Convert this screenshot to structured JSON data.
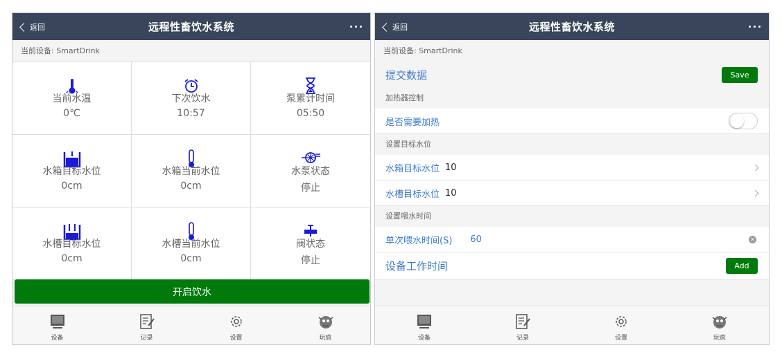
{
  "left": {
    "nav": {
      "back": "返回",
      "title": "远程性畜饮水系统"
    },
    "device_line": "当前设备: SmartDrink",
    "cells": [
      {
        "icon": "thermometer-icon",
        "label": "当前水温",
        "value": "0℃"
      },
      {
        "icon": "alarm-clock-icon",
        "label": "下次饮水",
        "value": "10:57"
      },
      {
        "icon": "hourglass-icon",
        "label": "泵累计时间",
        "value": "05:50"
      },
      {
        "icon": "water-tank-icon",
        "label": "水箱目标水位",
        "value": "0cm"
      },
      {
        "icon": "level-gauge-icon",
        "label": "水箱当前水位",
        "value": "0cm"
      },
      {
        "icon": "pump-icon",
        "label": "水泵状态",
        "value": "停止"
      },
      {
        "icon": "water-trough-icon",
        "label": "水槽目标水位",
        "value": "0cm"
      },
      {
        "icon": "level-gauge-icon",
        "label": "水槽当前水位",
        "value": "0cm"
      },
      {
        "icon": "valve-icon",
        "label": "阀状态",
        "value": "停止"
      }
    ],
    "start_button": "开启饮水"
  },
  "right": {
    "nav": {
      "back": "返回",
      "title": "远程性畜饮水系统"
    },
    "device_line": "当前设备: SmartDrink",
    "submit_label": "提交数据",
    "save_label": "Save",
    "heater_section": "加热器控制",
    "heat_label": "是否需要加热",
    "heat_on": false,
    "target_section": "设置目标水位",
    "tank_target_label": "水箱目标水位",
    "tank_target_value": "10",
    "trough_target_label": "水槽目标水位",
    "trough_target_value": "10",
    "feed_section": "设置喂水时间",
    "feed_time_label": "单次喂水时间(S)",
    "feed_time_value": "60",
    "work_time_label": "设备工作时间",
    "add_label": "Add"
  },
  "tabs": [
    {
      "icon": "monitor-icon",
      "label": "设备"
    },
    {
      "icon": "notepad-icon",
      "label": "记录"
    },
    {
      "icon": "gear-icon",
      "label": "设置"
    },
    {
      "icon": "mascot-icon",
      "label": "玩疯"
    }
  ],
  "colors": {
    "nav_bg": "#38455a",
    "accent_green": "#007a0a",
    "icon_blue": "#1a1ad8",
    "label_blue": "#3c7bc8"
  }
}
